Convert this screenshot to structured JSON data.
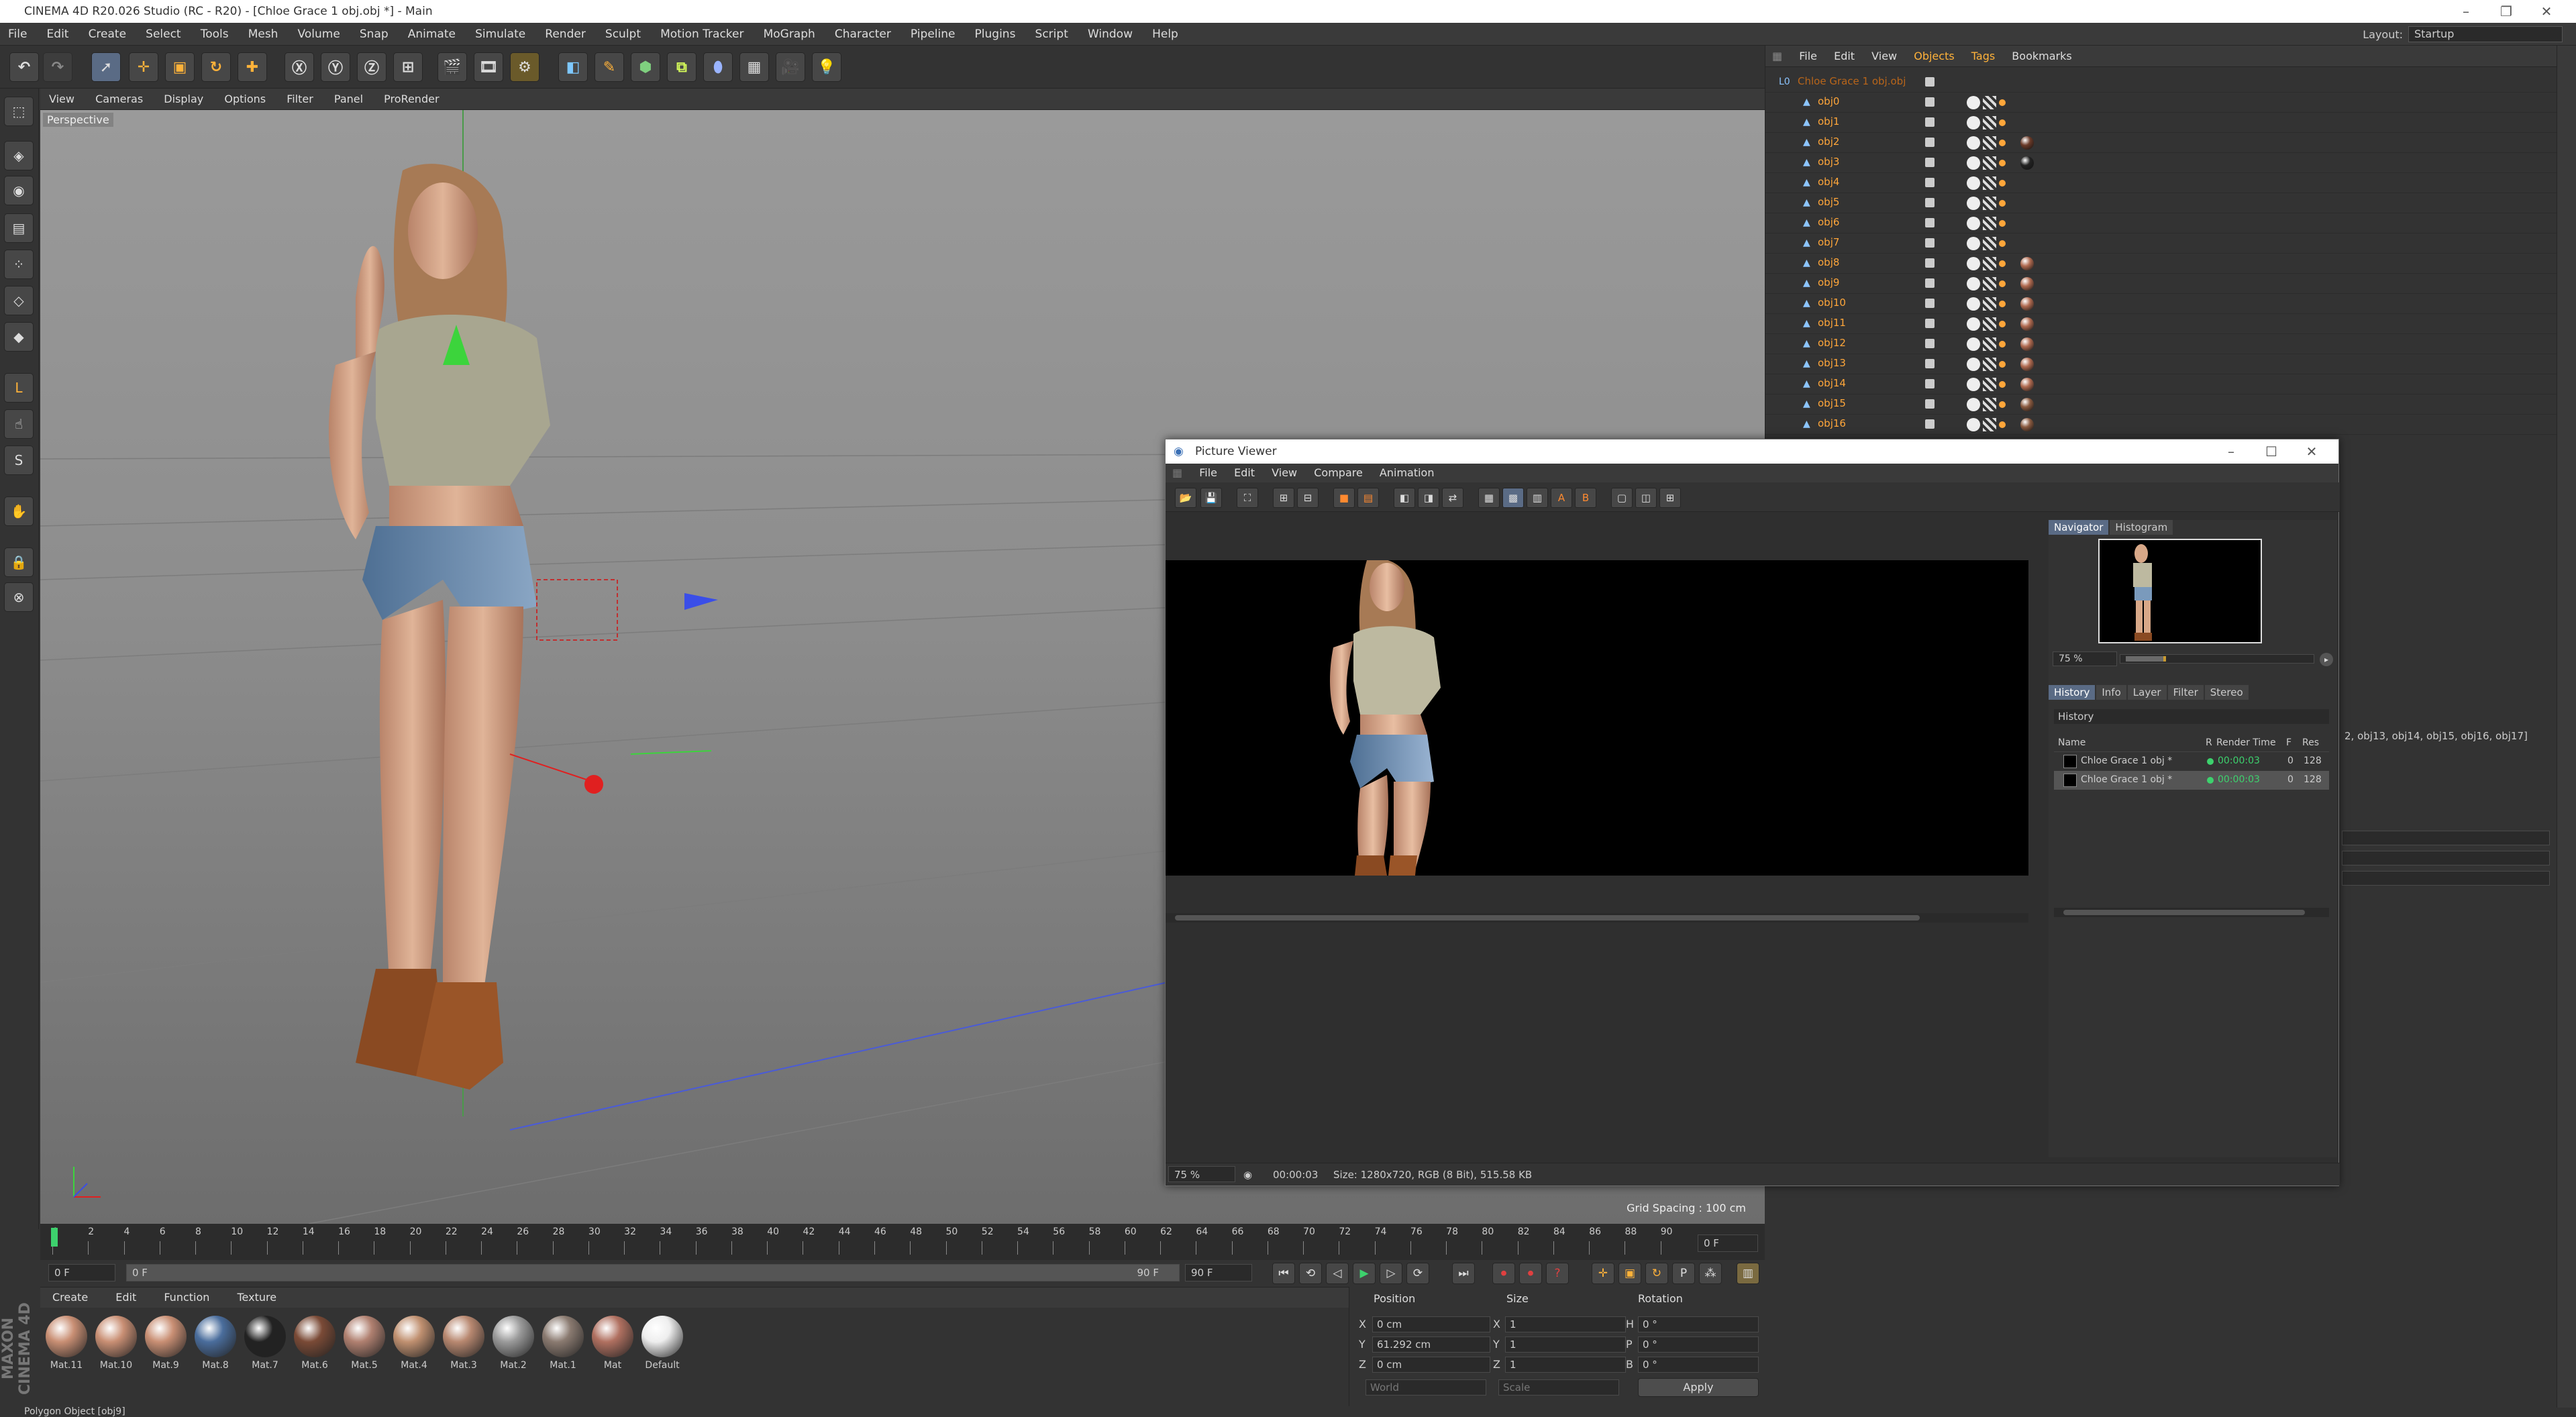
{
  "app": {
    "title": "CINEMA 4D R20.026 Studio (RC - R20) - [Chloe Grace 1 obj.obj *] - Main",
    "layout_label": "Layout:",
    "layout_value": "Startup"
  },
  "main_menu": [
    "File",
    "Edit",
    "Create",
    "Select",
    "Tools",
    "Mesh",
    "Volume",
    "Snap",
    "Animate",
    "Simulate",
    "Render",
    "Sculpt",
    "Motion Tracker",
    "MoGraph",
    "Character",
    "Pipeline",
    "Plugins",
    "Script",
    "Window",
    "Help"
  ],
  "viewport": {
    "menu": [
      "View",
      "Cameras",
      "Display",
      "Options",
      "Filter",
      "Panel",
      "ProRender"
    ],
    "camera_label": "Perspective",
    "grid_spacing": "Grid Spacing : 100 cm"
  },
  "timeline": {
    "ticks": [
      "0",
      "2",
      "4",
      "6",
      "8",
      "10",
      "12",
      "14",
      "16",
      "18",
      "20",
      "22",
      "24",
      "26",
      "28",
      "30",
      "32",
      "34",
      "36",
      "38",
      "40",
      "42",
      "44",
      "46",
      "48",
      "50",
      "52",
      "54",
      "56",
      "58",
      "60",
      "62",
      "64",
      "66",
      "68",
      "70",
      "72",
      "74",
      "76",
      "78",
      "80",
      "82",
      "84",
      "86",
      "88",
      "90"
    ],
    "end_frame_display": "0 F",
    "start_field": "0 F",
    "range_start": "0 F",
    "range_end": "90 F",
    "end_field": "90 F"
  },
  "materials": {
    "menu": [
      "Create",
      "Edit",
      "Function",
      "Texture"
    ],
    "items": [
      {
        "name": "Mat.11",
        "color": "#c98f74"
      },
      {
        "name": "Mat.10",
        "color": "#c98f74"
      },
      {
        "name": "Mat.9",
        "color": "#c98f74"
      },
      {
        "name": "Mat.8",
        "color": "#4a6d9c"
      },
      {
        "name": "Mat.7",
        "color": "#222222"
      },
      {
        "name": "Mat.6",
        "color": "#7a4a36"
      },
      {
        "name": "Mat.5",
        "color": "#b08070"
      },
      {
        "name": "Mat.4",
        "color": "#c09070"
      },
      {
        "name": "Mat.3",
        "color": "#b88870"
      },
      {
        "name": "Mat.2",
        "color": "#9a9a9a"
      },
      {
        "name": "Mat.1",
        "color": "#8a7a70"
      },
      {
        "name": "Mat",
        "color": "#b07060"
      },
      {
        "name": "Default",
        "color": "#eeeeee"
      }
    ]
  },
  "coords": {
    "headers": [
      "Position",
      "Size",
      "Rotation"
    ],
    "rows": [
      {
        "axis": "X",
        "pos": "0 cm",
        "size_axis": "X",
        "size": "1",
        "rot_axis": "H",
        "rot": "0 °"
      },
      {
        "axis": "Y",
        "pos": "61.292 cm",
        "size_axis": "Y",
        "size": "1",
        "rot_axis": "P",
        "rot": "0 °"
      },
      {
        "axis": "Z",
        "pos": "0 cm",
        "size_axis": "Z",
        "size": "1",
        "rot_axis": "B",
        "rot": "0 °"
      }
    ],
    "mode": "World",
    "scale_mode": "Scale",
    "apply": "Apply"
  },
  "status": "Polygon Object [obj9]",
  "brand": "MAXON CINEMA 4D",
  "objects": {
    "menu": [
      "File",
      "Edit",
      "View",
      "Objects",
      "Tags",
      "Bookmarks"
    ],
    "root": "Chloe Grace 1 obj.obj",
    "items": [
      "obj0",
      "obj1",
      "obj2",
      "obj3",
      "obj4",
      "obj5",
      "obj6",
      "obj7",
      "obj8",
      "obj9",
      "obj10",
      "obj11",
      "obj12",
      "obj13",
      "obj14",
      "obj15",
      "obj16"
    ]
  },
  "attributes": {
    "selection_text": "2, obj13, obj14, obj15, obj16, obj17]"
  },
  "picture_viewer": {
    "title": "Picture Viewer",
    "menu": [
      "File",
      "Edit",
      "View",
      "Compare",
      "Animation"
    ],
    "nav_tabs": [
      "Navigator",
      "Histogram"
    ],
    "zoom": "75 %",
    "zoom_status": "75 %",
    "time": "00:00:03",
    "size_info": "Size: 1280x720, RGB (8 Bit), 515.58 KB",
    "tabs": [
      "History",
      "Info",
      "Layer",
      "Filter",
      "Stereo"
    ],
    "history_title": "History",
    "history_headers": [
      "Name",
      "R",
      "Render Time",
      "F",
      "Res"
    ],
    "history_rows": [
      {
        "name": "Chloe Grace 1 obj *",
        "time": "00:00:03",
        "f": "0",
        "res": "128"
      },
      {
        "name": "Chloe Grace 1 obj *",
        "time": "00:00:03",
        "f": "0",
        "res": "128"
      }
    ]
  }
}
